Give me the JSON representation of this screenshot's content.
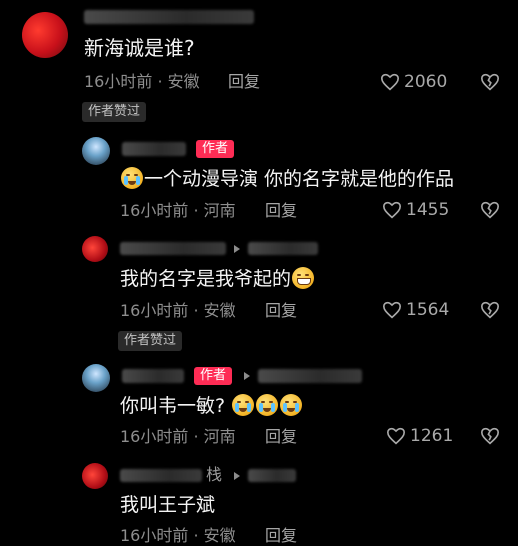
{
  "comments": [
    {
      "text": "新海诚是谁?",
      "time_location": "16小时前 · 安徽",
      "reply_label": "回复",
      "likes": "2060",
      "liked_by_author_label": "作者赞过"
    },
    {
      "author_badge": "作者",
      "text": "一个动漫导演 你的名字就是他的作品",
      "time_location": "16小时前 · 河南",
      "reply_label": "回复",
      "likes": "1455"
    },
    {
      "text": "我的名字是我爷起的",
      "time_location": "16小时前 · 安徽",
      "reply_label": "回复",
      "likes": "1564",
      "liked_by_author_label": "作者赞过"
    },
    {
      "author_badge": "作者",
      "text": "你叫韦一敏?",
      "time_location": "16小时前 · 河南",
      "reply_label": "回复",
      "likes": "1261"
    },
    {
      "username_fragment": "栈",
      "text": "我叫王子斌",
      "time_location": "16小时前 · 安徽",
      "reply_label": "回复"
    }
  ],
  "icons": {
    "like": "heart-outline-icon",
    "dislike": "broken-heart-icon",
    "reply_arrow": "triangle-right-icon"
  },
  "colors": {
    "background": "#000000",
    "author_badge": "#fe2c55",
    "meta_text": "#8e8e8e"
  }
}
